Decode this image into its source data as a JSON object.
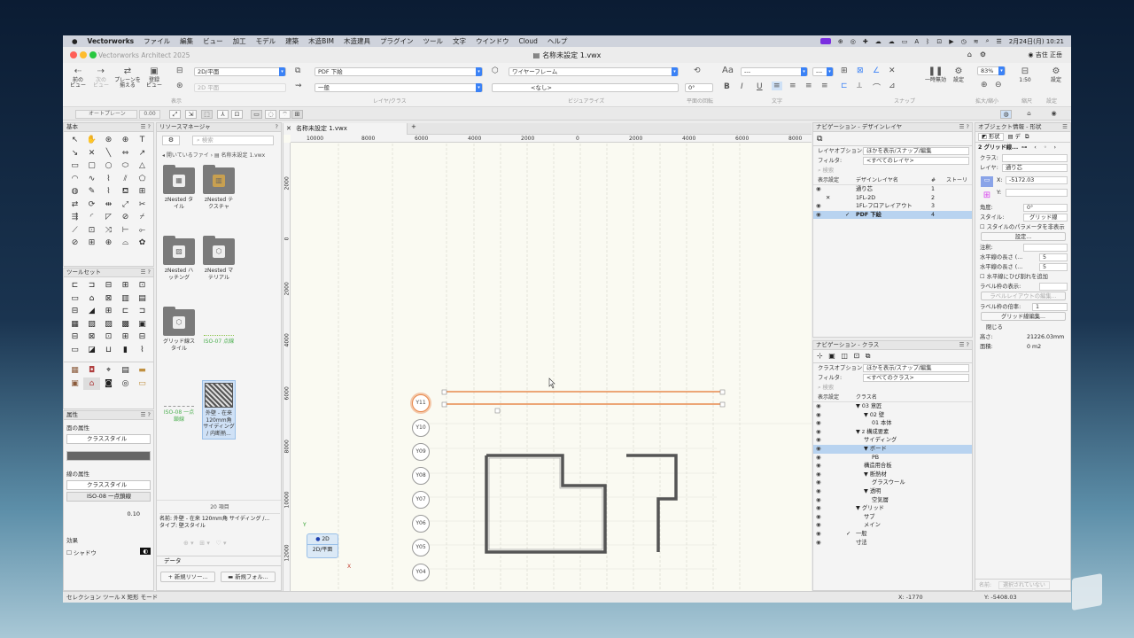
{
  "menubar": {
    "apple": "",
    "items": [
      "Vectorworks",
      "ファイル",
      "編集",
      "ビュー",
      "加工",
      "モデル",
      "建築",
      "木造BIM",
      "木造建具",
      "プラグイン",
      "ツール",
      "文字",
      "ウインドウ",
      "Cloud",
      "ヘルプ"
    ],
    "datetime": "2月24日(月)  10:21"
  },
  "window": {
    "app_name": "Vectorworks Architect 2025",
    "doc_title": "名称未設定 1.vwx"
  },
  "toolbar": {
    "prev_view": "前の\nビュー",
    "next_view": "次の\nビュー",
    "plane_show": "プレーンを\n揃える",
    "reg_view": "登録\nビュー",
    "view_select": "2D/平面",
    "view_select2": "2D 平面",
    "layer_select": "PDF 下絵",
    "class_select": "一般",
    "render_select": "ワイヤーフレーム",
    "none_select": "<なし>",
    "angle": "0°",
    "font_select": "---",
    "size_select": "---",
    "group_display": "表示",
    "group_layer_class": "レイヤ/クラス",
    "group_visualize": "ビジュアライズ",
    "group_plane_rot": "平面の回転",
    "group_text": "文字",
    "group_snap": "スナップ",
    "pause_label": "一時無効",
    "settings_label": "設定",
    "zoom_value": "83%",
    "scale_value": "1:50",
    "zoom_group": "拡大/縮小",
    "scale_group": "縮尺",
    "settings_group": "設定",
    "user_name": "吉住 正岳",
    "search_icon": "search-icon"
  },
  "toolbar2": {
    "auto_plane": "オートプレーン",
    "zero": "0.00"
  },
  "panels": {
    "basic_title": "基本",
    "toolset_title": "ツールセット",
    "attr_title": "属性",
    "attr_fill": "面の属性",
    "attr_fill_style": "クラススタイル",
    "attr_line": "線の属性",
    "attr_line_style": "クラススタイル",
    "attr_line_type": "ISO-08 一点鎖線",
    "attr_thickness": "0.10",
    "attr_effect": "効果",
    "attr_shadow": "シャドウ"
  },
  "resource": {
    "title": "リソースマネージャ",
    "search_placeholder": "検索",
    "path_open": "開いているファイ",
    "path_doc": "名称未設定 1.vwx",
    "tiles": [
      {
        "label": "zNested タイル"
      },
      {
        "label": "zNested テクスチャ"
      },
      {
        "label": "zNested ハッチング"
      },
      {
        "label": "zNested マテリアル"
      },
      {
        "label": "グリッド線スタイル"
      },
      {
        "label": "ISO-07 点線"
      },
      {
        "label": "ISO-08 一点鎖線"
      },
      {
        "label": "外壁 - 在来 120mm角 サイディング / 内断熱..."
      }
    ],
    "count": "20 項目",
    "name_line": "名前: 外壁 - 在来 120mm角 サイディング /...",
    "type_line": "タイプ: 壁スタイル",
    "data_tab": "データ",
    "new_resource": "新規リソー...",
    "new_folder": "新規フォル..."
  },
  "canvas": {
    "tab": "名称未設定 1.vwx",
    "hruler": [
      "10000",
      "8000",
      "6000",
      "4000",
      "2000",
      "0",
      "2000",
      "4000",
      "6000",
      "8000"
    ],
    "vruler": [
      "2000",
      "0",
      "2000",
      "4000",
      "6000",
      "8000",
      "10000",
      "12000"
    ],
    "grid_labels": [
      "Y11",
      "Y10",
      "Y09",
      "Y08",
      "Y07",
      "Y06",
      "Y05",
      "Y04"
    ],
    "view_badge_top": "2D",
    "view_badge_bottom": "2D/平面",
    "axis_x": "X",
    "axis_y": "Y"
  },
  "nav_layers": {
    "title": "ナビゲーション - デザインレイヤ",
    "option_label": "レイヤオプション:",
    "option_value": "ほかを表示/スナップ/編集",
    "filter_label": "フィルタ:",
    "filter_value": "<すべてのレイヤ>",
    "search_placeholder": "検索",
    "col_visible": "表示設定",
    "col_name": "デザインレイヤ名",
    "col_num": "#",
    "col_story": "ストーリ",
    "rows": [
      {
        "name": "通り芯",
        "num": "1",
        "mark": "",
        "sel": false,
        "eye": true
      },
      {
        "name": "1FL-2D",
        "num": "2",
        "mark": "✕",
        "sel": false,
        "eye": false
      },
      {
        "name": "1FL-フロアレイアウト",
        "num": "3",
        "mark": "",
        "sel": false,
        "eye": true
      },
      {
        "name": "PDF 下絵",
        "num": "4",
        "mark": "✓",
        "sel": true,
        "eye": true
      }
    ]
  },
  "nav_classes": {
    "title": "ナビゲーション - クラス",
    "option_label": "クラスオプション:",
    "option_value": "ほかを表示/スナップ/編集",
    "filter_label": "フィルタ:",
    "filter_value": "<すべてのクラス>",
    "search_placeholder": "検索",
    "col_visible": "表示設定",
    "col_name": "クラス名",
    "rows": [
      {
        "name": "▼ 03 意匠",
        "indent": 0,
        "sel": false,
        "mark": ""
      },
      {
        "name": "▼ 02 壁",
        "indent": 1,
        "sel": false,
        "mark": ""
      },
      {
        "name": "01 本体",
        "indent": 2,
        "sel": false,
        "mark": ""
      },
      {
        "name": "▼ z 構成要素",
        "indent": 0,
        "sel": false,
        "mark": ""
      },
      {
        "name": "サイディング",
        "indent": 1,
        "sel": false,
        "mark": ""
      },
      {
        "name": "▼ ボード",
        "indent": 1,
        "sel": true,
        "mark": ""
      },
      {
        "name": "PB",
        "indent": 2,
        "sel": false,
        "mark": ""
      },
      {
        "name": "構造用合板",
        "indent": 1,
        "sel": false,
        "mark": ""
      },
      {
        "name": "▼ 断熱材",
        "indent": 1,
        "sel": false,
        "mark": ""
      },
      {
        "name": "グラスウール",
        "indent": 2,
        "sel": false,
        "mark": ""
      },
      {
        "name": "▼ 透明",
        "indent": 1,
        "sel": false,
        "mark": ""
      },
      {
        "name": "空気層",
        "indent": 2,
        "sel": false,
        "mark": ""
      },
      {
        "name": "▼ グリッド",
        "indent": 0,
        "sel": false,
        "mark": ""
      },
      {
        "name": "サブ",
        "indent": 1,
        "sel": false,
        "mark": ""
      },
      {
        "name": "メイン",
        "indent": 1,
        "sel": false,
        "mark": ""
      },
      {
        "name": "一般",
        "indent": 0,
        "sel": false,
        "mark": "✓"
      },
      {
        "name": "寸法",
        "indent": 0,
        "sel": false,
        "mark": ""
      }
    ]
  },
  "obj_info": {
    "title": "オブジェクト情報 - 形状",
    "tab_shape": "形状",
    "tab_data": "デ",
    "object_name": "2 グリッド線...",
    "class_label": "クラス:",
    "class_value": "",
    "layer_label": "レイヤ:",
    "layer_value": "通り芯",
    "x_label": "X:",
    "x_value": "-5172.03",
    "y_label": "Y:",
    "y_value": "",
    "angle_label": "角度:",
    "angle_value": "0°",
    "style_label": "スタイル:",
    "style_value": "グリッド線",
    "hide_params": "スタイルのパラメータを非表示",
    "settings_btn": "設定...",
    "note_label": "注釈:",
    "h_len1_label": "水平線の長さ (...",
    "h_len1_value": "5",
    "h_len2_label": "水平線の長さ (...",
    "h_len2_value": "5",
    "h_crack": "水平線にひび割れを追加",
    "label_display": "ラベル枠の表示:",
    "label_layout_btn": "ラベルレイアウトの編集...",
    "label_scale_label": "ラベル枠の倍率:",
    "label_scale_value": "1",
    "grid_edit_btn": "グリッド線編集...",
    "closed_label": "閉じる",
    "height_label": "高さ:",
    "height_value": "21226.03mm",
    "area_label": "面積:",
    "area_value": "0 m2",
    "name_label": "名前:",
    "name_placeholder": "選択されていない"
  },
  "status": {
    "tool": "セレクション ツール",
    "mode": "X  矩形 モード",
    "x_coord": "X: -1770",
    "y_coord": "Y: -5408.03"
  },
  "colors": {
    "accent": "#3b82f6",
    "selection": "#b8d3f0",
    "grid_line_selected": "#e8894e",
    "wall": "#555555",
    "canvas_bg": "#fafaf2"
  }
}
